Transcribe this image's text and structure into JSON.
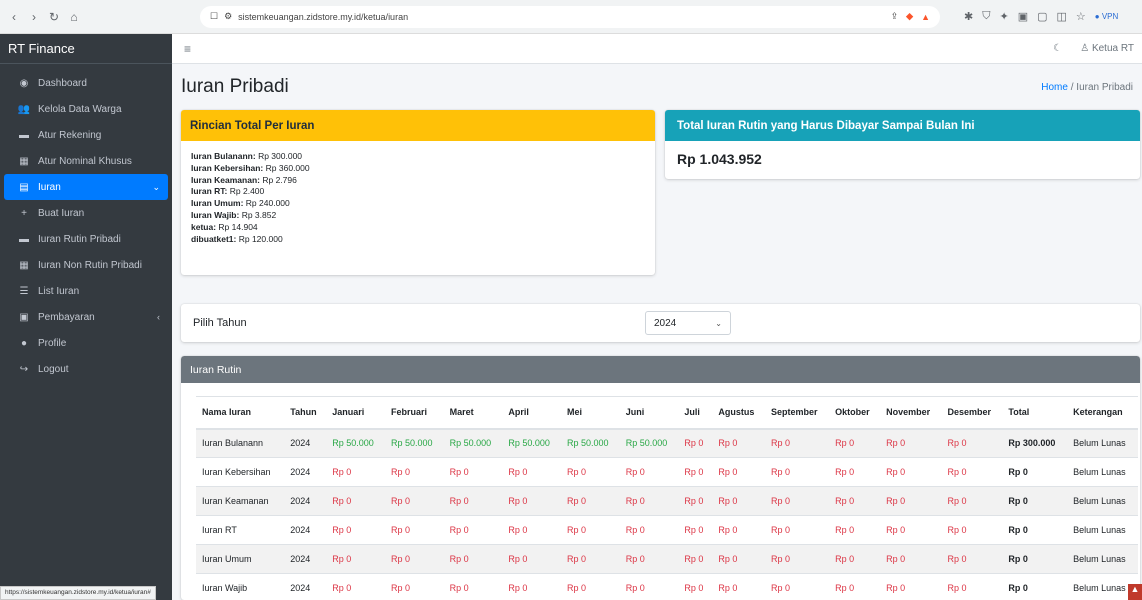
{
  "browser": {
    "url": "sistemkeuangan.zidstore.my.id/ketua/iuran",
    "vpn_label": "VPN"
  },
  "sidebar": {
    "brand": "RT Finance",
    "items": [
      {
        "label": "Dashboard",
        "icon": "dashboard-icon"
      },
      {
        "label": "Kelola Data Warga",
        "icon": "users-icon"
      },
      {
        "label": "Atur Rekening",
        "icon": "card-icon"
      },
      {
        "label": "Atur Nominal Khusus",
        "icon": "calculator-icon"
      },
      {
        "label": "Iuran",
        "icon": "wallet-icon"
      },
      {
        "label": "Buat Iuran",
        "icon": "plus-icon"
      },
      {
        "label": "Iuran Rutin Pribadi",
        "icon": "card-icon"
      },
      {
        "label": "Iuran Non Rutin Pribadi",
        "icon": "calendar-icon"
      },
      {
        "label": "List Iuran",
        "icon": "list-icon"
      },
      {
        "label": "Pembayaran",
        "icon": "money-icon"
      },
      {
        "label": "Profile",
        "icon": "user-icon"
      },
      {
        "label": "Logout",
        "icon": "logout-icon"
      }
    ]
  },
  "topbar": {
    "user_label": "Ketua RT"
  },
  "page": {
    "title": "Iuran Pribadi",
    "breadcrumb_home": "Home",
    "breadcrumb_sep": "/",
    "breadcrumb_current": "Iuran Pribadi"
  },
  "rincian": {
    "title": "Rincian Total Per Iuran",
    "items": [
      {
        "name": "Iuran Bulanann:",
        "value": "Rp 300.000"
      },
      {
        "name": "Iuran Kebersihan:",
        "value": "Rp 360.000"
      },
      {
        "name": "Iuran Keamanan:",
        "value": "Rp 2.796"
      },
      {
        "name": "Iuran RT:",
        "value": "Rp 2.400"
      },
      {
        "name": "Iuran Umum:",
        "value": "Rp 240.000"
      },
      {
        "name": "Iuran Wajib:",
        "value": "Rp 3.852"
      },
      {
        "name": "ketua:",
        "value": "Rp 14.904"
      },
      {
        "name": "dibuatket1:",
        "value": "Rp 120.000"
      }
    ]
  },
  "total_card": {
    "title": "Total Iuran Rutin yang Harus Dibayar Sampai Bulan Ini",
    "amount": "Rp 1.043.952"
  },
  "tahun": {
    "label": "Pilih Tahun",
    "selected": "2024"
  },
  "rutin": {
    "title": "Iuran Rutin",
    "columns": [
      "Nama Iuran",
      "Tahun",
      "Januari",
      "Februari",
      "Maret",
      "April",
      "Mei",
      "Juni",
      "Juli",
      "Agustus",
      "September",
      "Oktober",
      "November",
      "Desember",
      "Total",
      "Keterangan"
    ],
    "rows": [
      {
        "cells": [
          "Iuran Bulanann",
          "2024",
          "Rp 50.000",
          "Rp 50.000",
          "Rp 50.000",
          "Rp 50.000",
          "Rp 50.000",
          "Rp 50.000",
          "Rp 0",
          "Rp 0",
          "Rp 0",
          "Rp 0",
          "Rp 0",
          "Rp 0",
          "Rp 300.000",
          "Belum Lunas"
        ]
      },
      {
        "cells": [
          "Iuran Kebersihan",
          "2024",
          "Rp 0",
          "Rp 0",
          "Rp 0",
          "Rp 0",
          "Rp 0",
          "Rp 0",
          "Rp 0",
          "Rp 0",
          "Rp 0",
          "Rp 0",
          "Rp 0",
          "Rp 0",
          "Rp 0",
          "Belum Lunas"
        ]
      },
      {
        "cells": [
          "Iuran Keamanan",
          "2024",
          "Rp 0",
          "Rp 0",
          "Rp 0",
          "Rp 0",
          "Rp 0",
          "Rp 0",
          "Rp 0",
          "Rp 0",
          "Rp 0",
          "Rp 0",
          "Rp 0",
          "Rp 0",
          "Rp 0",
          "Belum Lunas"
        ]
      },
      {
        "cells": [
          "Iuran RT",
          "2024",
          "Rp 0",
          "Rp 0",
          "Rp 0",
          "Rp 0",
          "Rp 0",
          "Rp 0",
          "Rp 0",
          "Rp 0",
          "Rp 0",
          "Rp 0",
          "Rp 0",
          "Rp 0",
          "Rp 0",
          "Belum Lunas"
        ]
      },
      {
        "cells": [
          "Iuran Umum",
          "2024",
          "Rp 0",
          "Rp 0",
          "Rp 0",
          "Rp 0",
          "Rp 0",
          "Rp 0",
          "Rp 0",
          "Rp 0",
          "Rp 0",
          "Rp 0",
          "Rp 0",
          "Rp 0",
          "Rp 0",
          "Belum Lunas"
        ]
      },
      {
        "cells": [
          "Iuran Wajib",
          "2024",
          "Rp 0",
          "Rp 0",
          "Rp 0",
          "Rp 0",
          "Rp 0",
          "Rp 0",
          "Rp 0",
          "Rp 0",
          "Rp 0",
          "Rp 0",
          "Rp 0",
          "Rp 0",
          "Rp 0",
          "Belum Lunas"
        ]
      }
    ]
  },
  "status_bar": {
    "url": "https://sistemkeuangan.zidstore.my.id/ketua/iuran#"
  },
  "colors": {
    "paid": "#28a745",
    "unpaid": "#dc3545",
    "warning_header": "#ffc107",
    "info_header": "#17a2b8",
    "active_menu": "#007bff"
  }
}
